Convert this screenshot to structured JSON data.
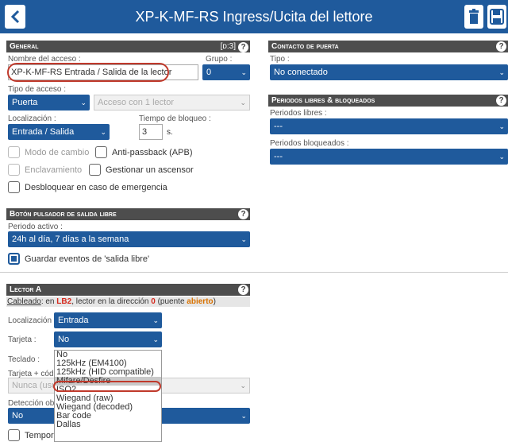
{
  "header": {
    "title": "XP-K-MF-RS Ingress/Ucita del lettore"
  },
  "general": {
    "title": "General",
    "id_tag": "[ᴅ:3]",
    "name_label": "Nombre del acceso :",
    "name_value": "XP-K-MF-RS Entrada / Salida de la lector",
    "group_label": "Grupo :",
    "group_value": "0",
    "access_type_label": "Tipo de acceso :",
    "access_type_value": "Puerta",
    "access_mode_value": "Acceso con 1 lector",
    "location_label": "Localización :",
    "location_value": "Entrada / Salida",
    "lock_time_label": "Tiempo de bloqueo :",
    "lock_time_value": "3",
    "lock_time_unit": "s.",
    "change_mode_label": "Modo de cambio",
    "antipassback_label": "Anti-passback (APB)",
    "interlock_label": "Enclavamiento",
    "elevator_label": "Gestionar un ascensor",
    "emergency_label": "Desbloquear en caso de emergencia"
  },
  "exit_button": {
    "title": "Botón pulsador de salida libre",
    "period_label": "Periodo activo :",
    "period_value": "24h al día, 7 días a la semana",
    "save_events_label": "Guardar eventos de 'salida libre'"
  },
  "door_contact": {
    "title": "Contacto de puerta",
    "type_label": "Tipo :",
    "type_value": "No conectado"
  },
  "periods": {
    "title": "Periodos libres & bloqueados",
    "free_label": "Periodos libres :",
    "free_value": "---",
    "blocked_label": "Periodos bloqueados :",
    "blocked_value": "---"
  },
  "reader_a": {
    "title": "Lector A",
    "cabling_word": "Cableado",
    "cabling_pre": ": en ",
    "cabling_bus": "LB2",
    "cabling_mid": ", lector en la dirección ",
    "cabling_addr": "0",
    "cabling_post1": " (puente ",
    "cabling_jumper": "abierto",
    "cabling_post2": ")",
    "location_label": "Localización :",
    "location_value": "Entrada",
    "card_label": "Tarjeta :",
    "card_value": "No",
    "keypad_label": "Teclado :",
    "card_code_label": "Tarjeta + códig",
    "card_code_value": "Nunca (usu",
    "detection_label": "Detección obli",
    "detection_value": "No",
    "timer_label": "Temporiz",
    "card_options": [
      "No",
      "125kHz (EM4100)",
      "125kHz (HID compatible)",
      "Mifare/Desfire",
      "ISO2",
      "Wiegand (raw)",
      "Wiegand (decoded)",
      "Bar code",
      "Dallas"
    ],
    "card_highlighted": "Mifare/Desfire"
  },
  "colors": {
    "accent": "#1f5a9c",
    "header_bar": "#4d4d4d",
    "highlight_oval": "#c0392b"
  }
}
